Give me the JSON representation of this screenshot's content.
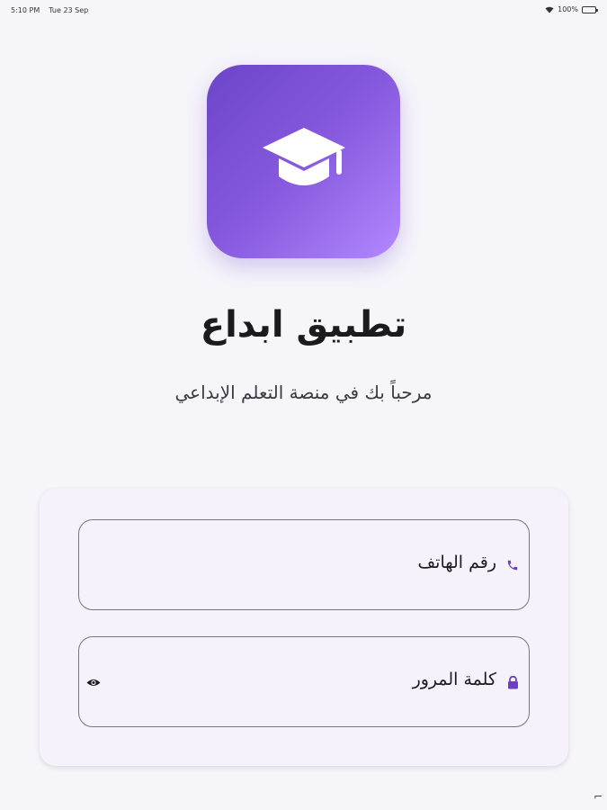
{
  "status_bar": {
    "time": "5:10 PM",
    "date": "Tue 23 Sep",
    "battery": "100%"
  },
  "app": {
    "title": "تطبيق ابداع",
    "subtitle": "مرحباً بك في منصة التعلم الإبداعي"
  },
  "form": {
    "phone_label": "رقم الهاتف",
    "password_label": "كلمة المرور"
  },
  "colors": {
    "accent": "#7b4fd6",
    "gradient_start": "#6c45c9",
    "gradient_end": "#b388ff",
    "card_background": "#f6f2fb",
    "field_border": "#79747e"
  },
  "icons": {
    "logo": "graduation-cap-icon",
    "phone": "phone-icon",
    "password": "lock-icon",
    "visibility": "eye-icon"
  }
}
